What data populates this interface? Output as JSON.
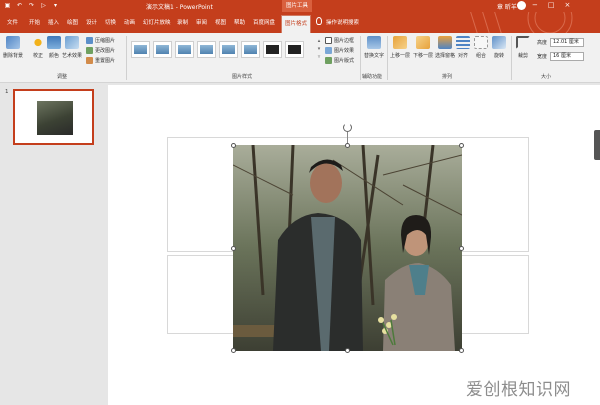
{
  "window": {
    "document_title": "演示文稿1 - PowerPoint",
    "context_tab_group": "图片工具",
    "user_name": "章 昕羊",
    "window_buttons": [
      "−",
      "□",
      "×"
    ]
  },
  "tabs": [
    {
      "label": "文件",
      "active": false
    },
    {
      "label": "开始",
      "active": false
    },
    {
      "label": "插入",
      "active": false
    },
    {
      "label": "绘图",
      "active": false
    },
    {
      "label": "设计",
      "active": false
    },
    {
      "label": "切换",
      "active": false
    },
    {
      "label": "动画",
      "active": false
    },
    {
      "label": "幻灯片放映",
      "active": false
    },
    {
      "label": "录制",
      "active": false
    },
    {
      "label": "审阅",
      "active": false
    },
    {
      "label": "视图",
      "active": false
    },
    {
      "label": "帮助",
      "active": false
    },
    {
      "label": "百度网盘",
      "active": false
    },
    {
      "label": "图片格式",
      "active": true
    }
  ],
  "tell_me": "操作说明搜索",
  "ribbon": {
    "adjust": {
      "group_label": "调整",
      "remove_bg": "删除背景",
      "corrections": "校正",
      "color": "颜色",
      "artistic": "艺术效果",
      "compress": "压缩图片",
      "change": "更改图片",
      "reset": "重置图片"
    },
    "styles": {
      "group_label": "图片样式",
      "border": "图片边框",
      "effects": "图片效果",
      "layout": "图片版式"
    },
    "accessibility": {
      "group_label": "辅助功能",
      "alt_text": "替换文字"
    },
    "arrange": {
      "group_label": "排列",
      "bring_forward": "上移一层",
      "send_backward": "下移一层",
      "selection_pane": "选择窗格",
      "align": "对齐",
      "group": "组合",
      "rotate": "旋转"
    },
    "size": {
      "group_label": "大小",
      "crop": "裁剪",
      "height_label": "高度",
      "height_value": "12.01 厘米",
      "width_label": "宽度",
      "width_value": "16 厘米"
    }
  },
  "slides": [
    {
      "number": "1"
    }
  ],
  "watermark": "爱创根知识网",
  "colors": {
    "accent": "#c43e1c",
    "ribbon_bg": "#f1f1f1",
    "workspace_bg": "#e6e6e6"
  }
}
